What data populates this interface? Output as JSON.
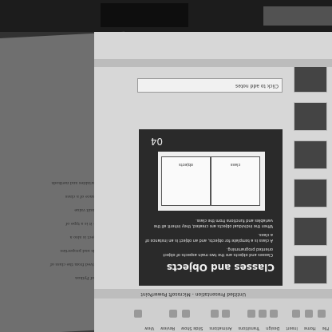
{
  "scene": {
    "description_hidden": ""
  },
  "ribbon": {
    "tabs": [
      "File",
      "Home",
      "Insert",
      "Design",
      "Transitions",
      "Animations",
      "Slide Show",
      "Review",
      "View"
    ]
  },
  "window": {
    "title": "Untitled Presentation - Microsoft PowerPoint"
  },
  "slide": {
    "title": "Classes and Objects",
    "bullets": [
      "Classes and objects are the two main aspects of object oriented programming.",
      "A class is a template for objects, and an object is an instance of a class.",
      "When the individual objects are created, they inherit all the variables and functions from the class."
    ],
    "diagram": {
      "left_label": "class",
      "right_label": "objects"
    },
    "number": "04"
  },
  "notes": {
    "placeholder": "Click to add notes"
  },
  "board_writing": {
    "lines": [
      "Basics of Python",
      "are derived from the class of",
      "methods and properties",
      "the Object is also a",
      "class — it is a type of",
      "the default value",
      "an instance of a class",
      "class variables and methods"
    ]
  }
}
